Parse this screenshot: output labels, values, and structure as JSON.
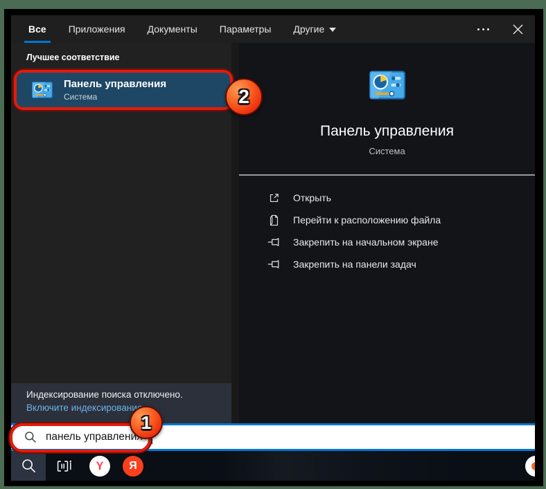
{
  "tabs": {
    "items": [
      {
        "label": "Все",
        "selected": true
      },
      {
        "label": "Приложения",
        "selected": false
      },
      {
        "label": "Документы",
        "selected": false
      },
      {
        "label": "Параметры",
        "selected": false
      },
      {
        "label": "Другие",
        "selected": false,
        "has_dropdown": true
      }
    ]
  },
  "left_panel": {
    "section_header": "Лучшее соответствие",
    "best_match": {
      "title": "Панель управления",
      "subtitle": "Система"
    },
    "footer": {
      "line1": "Индексирование поиска отключено.",
      "link": "Включите индексирование."
    }
  },
  "right_panel": {
    "title": "Панель управления",
    "subtitle": "Система",
    "actions": [
      {
        "icon": "open-icon",
        "label": "Открыть"
      },
      {
        "icon": "file-location-icon",
        "label": "Перейти к расположению файла"
      },
      {
        "icon": "pin-icon",
        "label": "Закрепить на начальном экране"
      },
      {
        "icon": "pin-icon",
        "label": "Закрепить на панели задач"
      }
    ]
  },
  "search": {
    "value": "панель управления"
  },
  "annotations": {
    "badges": [
      {
        "number": "1"
      },
      {
        "number": "2"
      }
    ],
    "highlight_color": "#e41b0c",
    "badge_color": "#fb5a1e"
  },
  "taskbar": {
    "icons": [
      "search-icon",
      "task-view-icon",
      "yandex-browser-icon",
      "yandex-search-icon"
    ],
    "yandex_browser_letter": "Y",
    "yandex_letter": "Я"
  },
  "colors": {
    "accent": "#0078d7",
    "selection": "#1e4765",
    "link": "#6fb2e8",
    "frame_green": "#4b6b53",
    "window_bg": "#1f1f1f"
  }
}
